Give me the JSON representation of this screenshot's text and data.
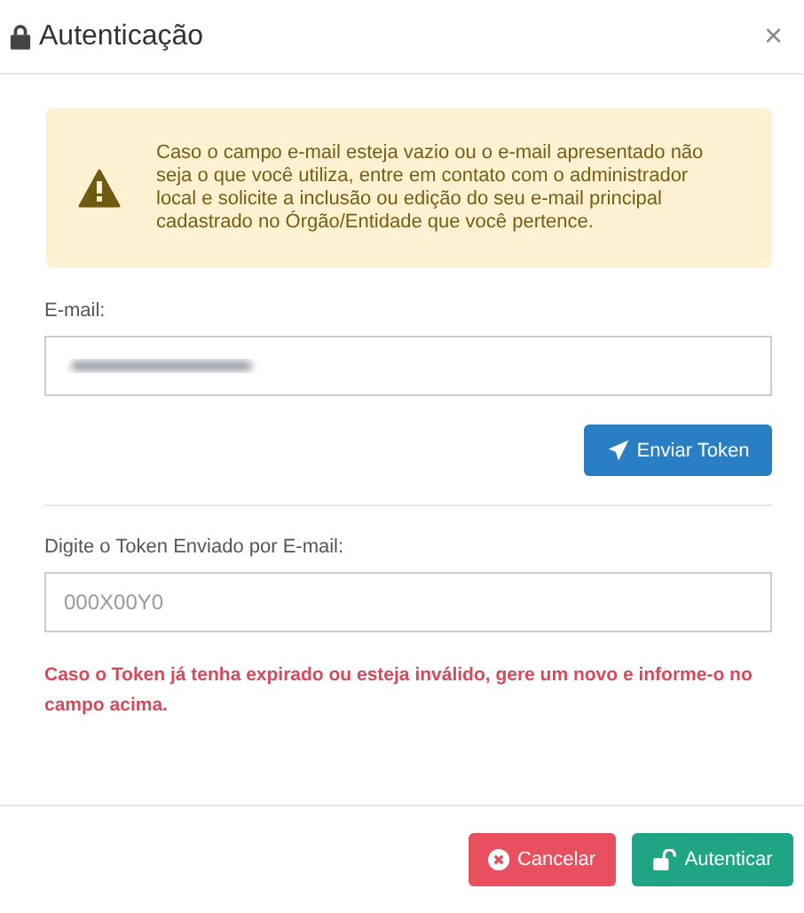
{
  "dialog": {
    "title": "Autenticação",
    "close": "×"
  },
  "alert": {
    "text": "Caso o campo e-mail esteja vazio ou o e-mail apresentado não seja o que você utiliza, entre em contato com o administrador local e solicite a inclusão ou edição do seu e-mail principal cadastrado no Órgão/Entidade que você pertence."
  },
  "email": {
    "label": "E-mail:",
    "blurred": true
  },
  "send_button": {
    "label": "Enviar Token"
  },
  "token": {
    "label": "Digite o Token Enviado por E-mail:",
    "placeholder": "000X00Y0"
  },
  "error": {
    "text": "Caso o Token já tenha expirado ou esteja inválido, gere um novo e informe-o no campo acima."
  },
  "buttons": [
    {
      "kind": "cancel",
      "label": "Cancelar"
    },
    {
      "kind": "confirm",
      "label": "Autenticar"
    }
  ]
}
